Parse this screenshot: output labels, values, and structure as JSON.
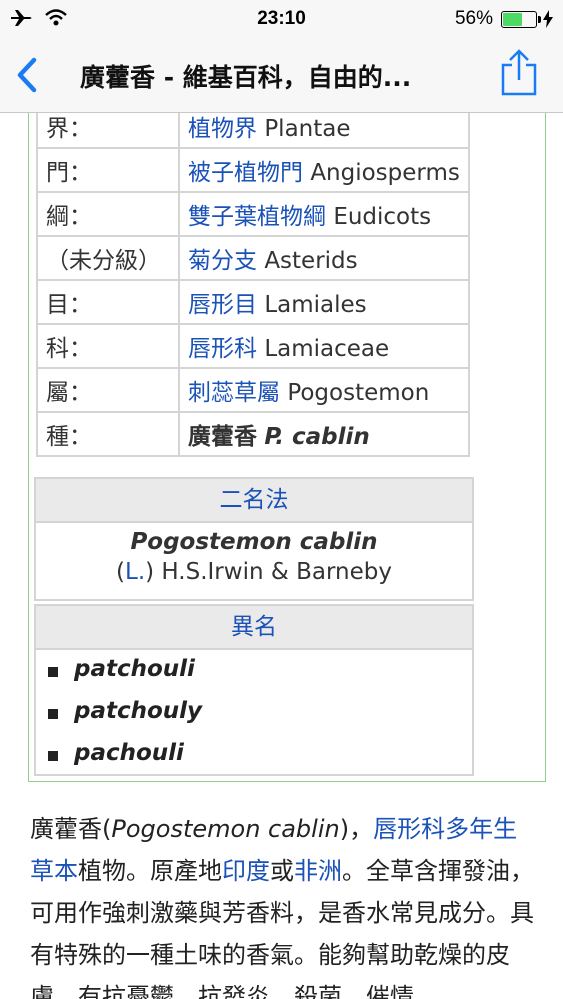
{
  "status_bar": {
    "time": "23:10",
    "battery_percent": "56%",
    "battery_level": 0.56
  },
  "nav": {
    "title": "廣藿香 - 維基百科，自由的..."
  },
  "taxonomy": [
    {
      "rank": "界：",
      "link": "植物界",
      "latin": "Plantae"
    },
    {
      "rank": "門：",
      "link": "被子植物門",
      "latin": "Angiosperms"
    },
    {
      "rank": "綱：",
      "link": "雙子葉植物綱",
      "latin": "Eudicots"
    },
    {
      "rank": "（未分級）",
      "link": "菊分支",
      "latin": "Asterids"
    },
    {
      "rank": "目：",
      "link": "唇形目",
      "latin": "Lamiales"
    },
    {
      "rank": "科：",
      "link": "唇形科",
      "latin": "Lamiaceae"
    },
    {
      "rank": "屬：",
      "link": "刺蕊草屬",
      "latin": "Pogostemon"
    },
    {
      "rank": "種：",
      "link": "廣藿香",
      "latin": "P. cablin"
    }
  ],
  "binomial": {
    "header": "二名法",
    "name": "Pogostemon cablin",
    "open_paren": "(",
    "author_link": "L.",
    "authority": ") H.S.Irwin & Barneby"
  },
  "synonyms": {
    "header": "異名",
    "items": [
      "patchouli",
      "patchouly",
      "pachouli"
    ]
  },
  "paragraph": {
    "t1": "廣藿香(",
    "t1_italic": "Pogostemon cablin",
    "t2": ")，",
    "l1": "唇形科",
    "l2": "多年生草本",
    "t3": "植物。原產地",
    "l3": "印度",
    "t4": "或",
    "l4": "非洲",
    "t5": "。全草含揮發油，可用作強刺激藥與芳香料，是香水常見成分。具有特殊的一種土味的香氣。能夠幫助乾燥的皮膚，有抗憂鬱、抗發炎、殺菌、催情、"
  }
}
